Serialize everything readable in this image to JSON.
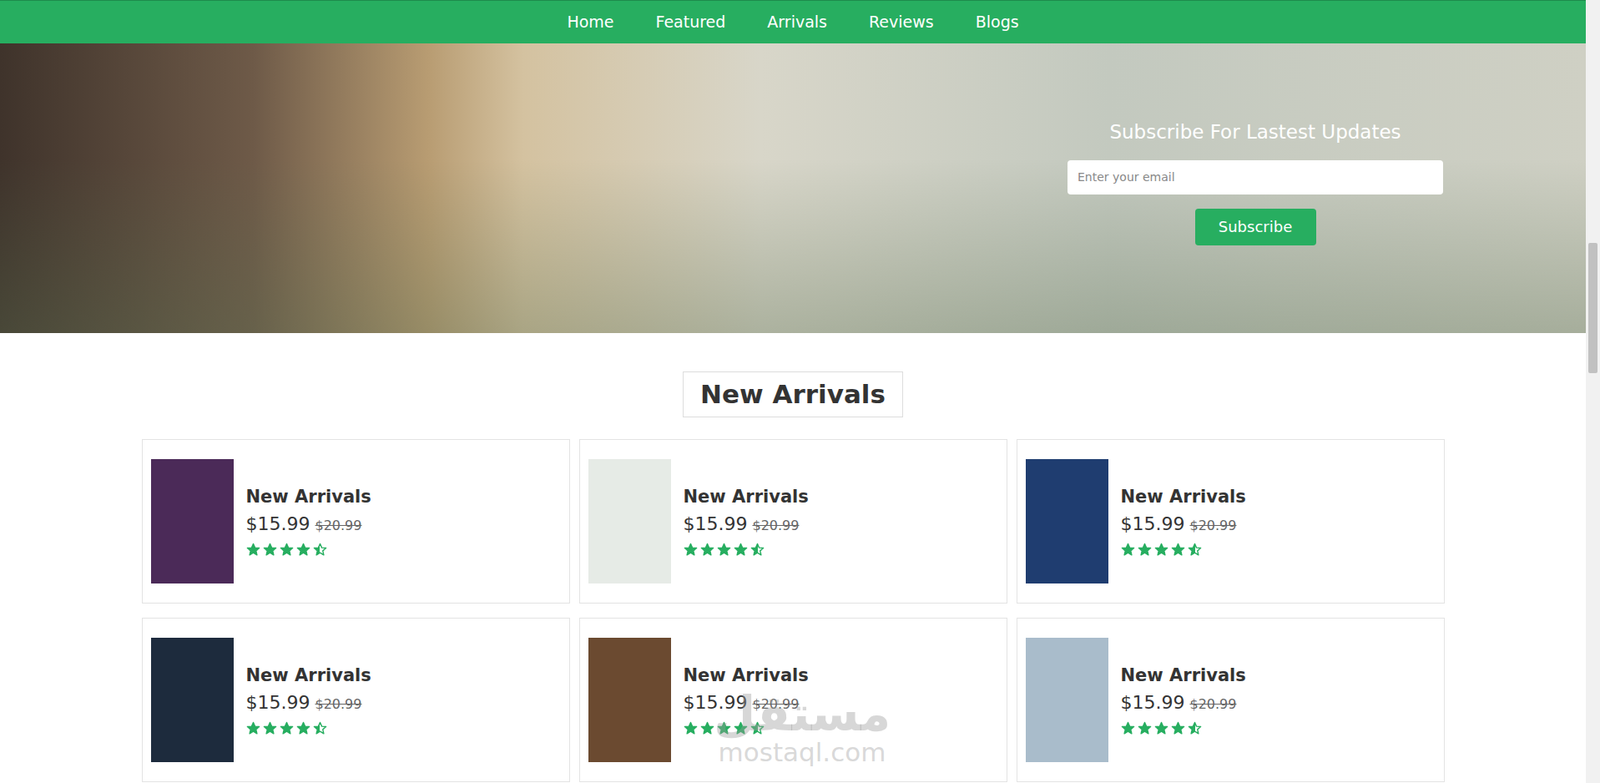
{
  "nav": [
    "Home",
    "Featured",
    "Arrivals",
    "Reviews",
    "Blogs"
  ],
  "hero": {
    "title": "Subscribe For Lastest Updates",
    "email_placeholder": "Enter your email",
    "button": "Subscribe"
  },
  "section": {
    "title": "New Arrivals"
  },
  "products": [
    {
      "title": "New Arrivals",
      "price": "$15.99",
      "old_price": "$20.99",
      "stars": 4.5,
      "color": "#4b2a58"
    },
    {
      "title": "New Arrivals",
      "price": "$15.99",
      "old_price": "$20.99",
      "stars": 4.5,
      "color": "#e6ebe6"
    },
    {
      "title": "New Arrivals",
      "price": "$15.99",
      "old_price": "$20.99",
      "stars": 4.5,
      "color": "#1f3d70"
    },
    {
      "title": "New Arrivals",
      "price": "$15.99",
      "old_price": "$20.99",
      "stars": 4.5,
      "color": "#1d2b3d"
    },
    {
      "title": "New Arrivals",
      "price": "$15.99",
      "old_price": "$20.99",
      "stars": 4.5,
      "color": "#6b4a30"
    },
    {
      "title": "New Arrivals",
      "price": "$15.99",
      "old_price": "$20.99",
      "stars": 4.5,
      "color": "#a9bccb"
    }
  ],
  "watermark": {
    "arabic": "مستقل",
    "latin": "mostaql.com"
  },
  "scroll": {
    "level": 0.31
  }
}
